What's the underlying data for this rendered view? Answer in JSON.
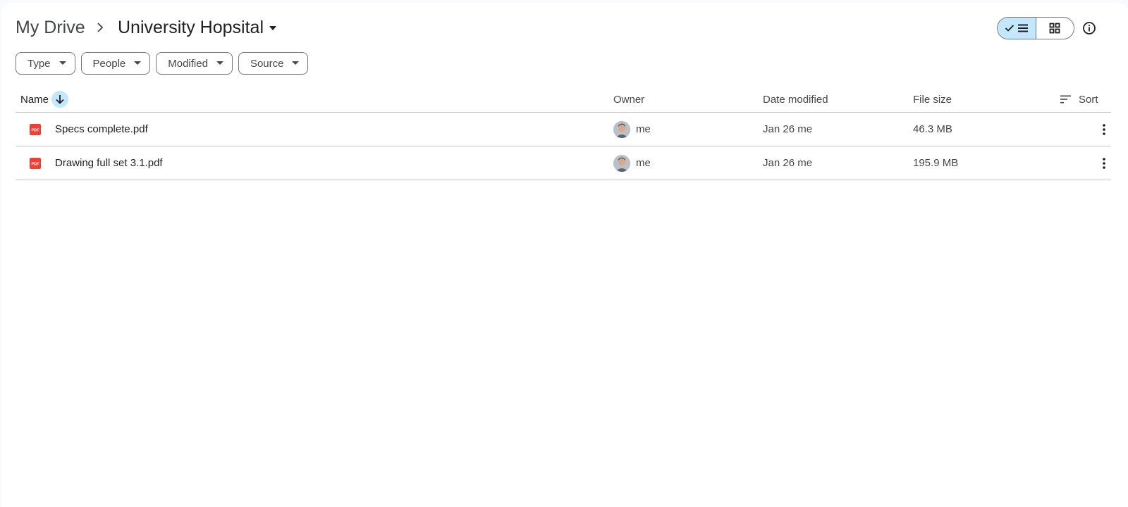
{
  "breadcrumb": {
    "root": "My Drive",
    "current": "University Hopsital"
  },
  "view_toggle": {
    "active": "list",
    "list_icon": "list-check-icon",
    "grid_icon": "grid-icon"
  },
  "info_icon": "info-icon",
  "filters": [
    {
      "label": "Type"
    },
    {
      "label": "People"
    },
    {
      "label": "Modified"
    },
    {
      "label": "Source"
    }
  ],
  "table": {
    "headers": {
      "name": "Name",
      "owner": "Owner",
      "date_modified": "Date modified",
      "file_size": "File size",
      "sort": "Sort"
    },
    "rows": [
      {
        "name": "Specs complete.pdf",
        "owner": "me",
        "date_modified": "Jan 26 me",
        "file_size": "46.3 MB",
        "type_icon": "pdf-icon"
      },
      {
        "name": "Drawing full set 3.1.pdf",
        "owner": "me",
        "date_modified": "Jan 26 me",
        "file_size": "195.9 MB",
        "type_icon": "pdf-icon"
      }
    ]
  },
  "colors": {
    "accent_selected": "#c2e7ff",
    "pdf_red": "#ea4335",
    "divider": "#c4c7c5"
  }
}
